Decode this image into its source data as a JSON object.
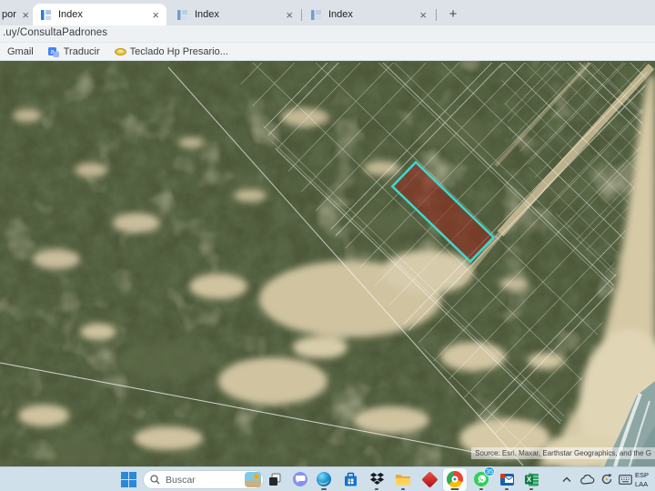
{
  "browser": {
    "partial_tab_title": "por",
    "tabs": [
      "Index",
      "Index",
      "Index"
    ],
    "new_tab_label": "+",
    "url": ".uy/ConsultaPadrones",
    "bookmarks": {
      "gmail": "Gmail",
      "traducir": "Traducir",
      "teclado": "Teclado Hp Presario..."
    }
  },
  "map": {
    "attribution": "Source: Esri, Maxar, Earthstar Geographics, and the G",
    "highlight_parcel": {
      "stroke": "#3fd9cf",
      "fill": "rgba(150,42,30,0.58)"
    },
    "palette": {
      "forest": "#4d5839",
      "sand": "#cfc3a0",
      "beach": "#d5c9a6",
      "ocean": "#8ea7a4",
      "parcel_lines": "#ffffff"
    }
  },
  "taskbar": {
    "search_placeholder": "Buscar",
    "whatsapp_badge": "35",
    "language": {
      "line1": "ESP",
      "line2": "LAA"
    }
  }
}
